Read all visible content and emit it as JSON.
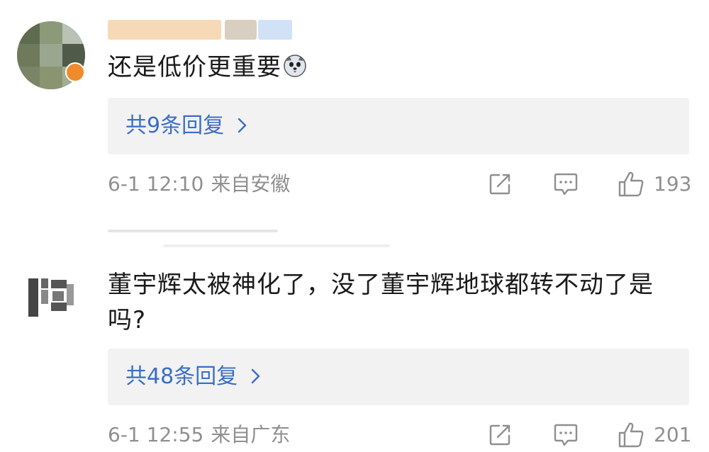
{
  "comments": [
    {
      "text": "还是低价更重要",
      "reply_label": "共9条回复",
      "time": "6-1 12:10",
      "location": "来自安徽",
      "likes": "193",
      "emoji_icon": "husky-dog-icon"
    },
    {
      "text_line1": "董宇辉太被神化了，没了董宇辉地球都转不动了是",
      "text_line2": "吗?",
      "reply_label": "共48条回复",
      "time": "6-1 12:55",
      "location": "来自广东",
      "likes": "201"
    }
  ],
  "colors": {
    "link": "#3b6dc6",
    "meta": "#8f8f8f",
    "reply_bg": "#f2f2f2",
    "text": "#1a1a1a"
  }
}
